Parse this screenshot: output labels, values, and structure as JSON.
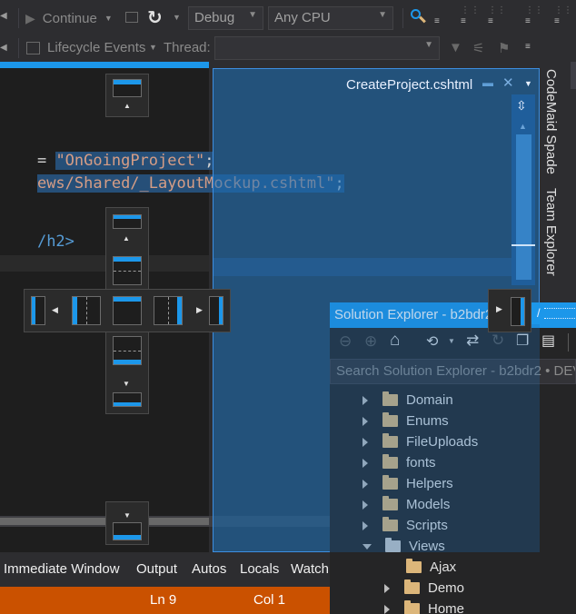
{
  "toolbar": {
    "continue_label": "Continue",
    "config_value": "Debug",
    "platform_value": "Any CPU",
    "lifecycle_label": "Lifecycle Events",
    "thread_label": "Thread:"
  },
  "editor": {
    "tab_label": "cshtml",
    "code_line1_string": "\"OnGoingProject\"",
    "code_line1_prefix": "= ",
    "code_line1_suffix": ";",
    "code_line2_string": "ews/Shared/_LayoutMockup.cshtml\"",
    "code_line2_suffix": ";",
    "code_line4": "/h2>"
  },
  "preview": {
    "title": "CreateProject.cshtml"
  },
  "side_tabs": {
    "codemaid": "CodeMaid Spade",
    "team_explorer": "Team Explorer"
  },
  "solution_explorer": {
    "title": "Solution Explorer - b2bdr2",
    "search_placeholder": "Search Solution Explorer - b2bdr2 • DEV",
    "items": [
      {
        "label": "Domain",
        "state": "collapsed"
      },
      {
        "label": "Enums",
        "state": "collapsed"
      },
      {
        "label": "FileUploads",
        "state": "collapsed"
      },
      {
        "label": "fonts",
        "state": "collapsed"
      },
      {
        "label": "Helpers",
        "state": "collapsed"
      },
      {
        "label": "Models",
        "state": "collapsed"
      },
      {
        "label": "Scripts",
        "state": "collapsed"
      },
      {
        "label": "Views",
        "state": "expanded"
      },
      {
        "label": "Ajax",
        "state": "none"
      },
      {
        "label": "Demo",
        "state": "collapsed"
      },
      {
        "label": "Home",
        "state": "collapsed"
      }
    ]
  },
  "bottom_tabs": [
    "Immediate Window",
    "Output",
    "Autos",
    "Locals",
    "Watch"
  ],
  "status_bar": {
    "line": "Ln 9",
    "col": "Col 1"
  },
  "colors": {
    "accent": "#1c97ea",
    "status_bar": "#ca5100",
    "dock_overlay": "#1c71ba",
    "string": "#d69d85"
  }
}
